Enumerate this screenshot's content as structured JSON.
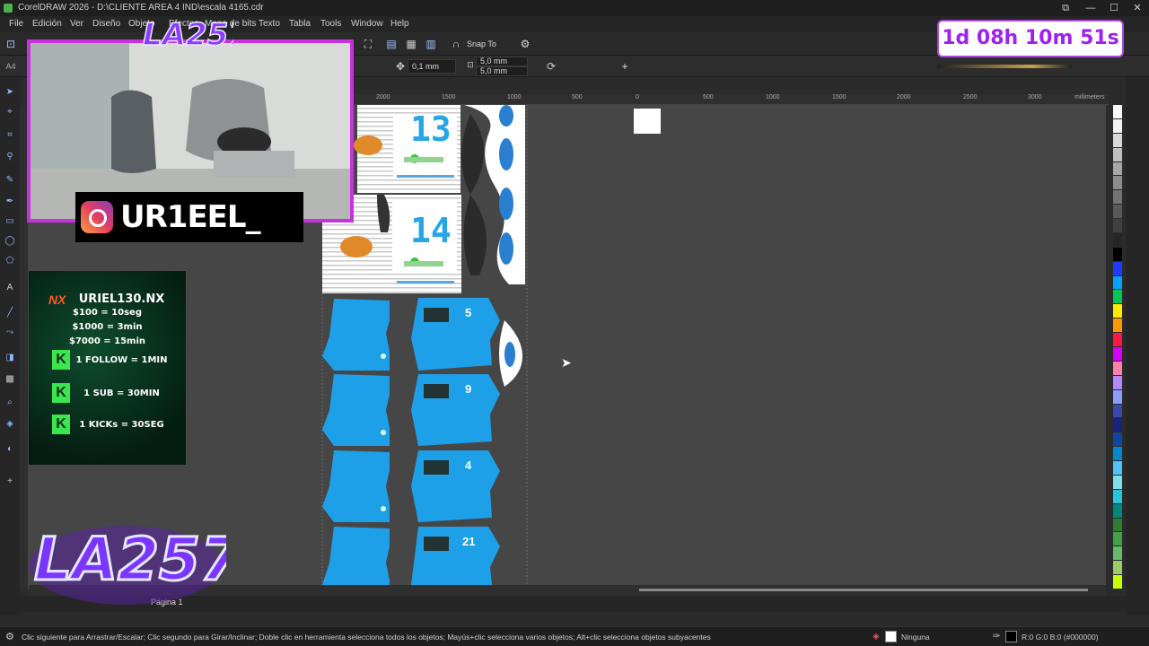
{
  "window": {
    "title": "CorelDRAW 2026 - D:\\CLIENTE AREA 4 IND\\escala 4165.cdr",
    "controls": [
      "⧉",
      "—",
      "☐",
      "✕"
    ]
  },
  "menu": [
    "File",
    "Edición",
    "Ver",
    "Diseño",
    "Objeto",
    "Efectos",
    "Mapa de bits",
    "Texto",
    "Tabla",
    "Tools",
    "Window",
    "Help"
  ],
  "toolbar": {
    "snap_label": "Snap To",
    "outline_width": "0,1 mm",
    "nudge_x": "5,0 mm",
    "nudge_y": "5,0 mm"
  },
  "ruler": {
    "labels": [
      "2000",
      "1500",
      "1000",
      "500",
      "0",
      "500",
      "1000",
      "1500",
      "2000",
      "2500",
      "3000"
    ],
    "unit": "millimeters"
  },
  "overlay": {
    "timer": "1d 08h 10m 51s",
    "instagram_handle": "UR1EEL_",
    "donation": {
      "brand": "NX",
      "name": "URIEL130.NX",
      "lines": [
        "$100 = 10seg",
        "$1000 = 3min",
        "$7000 = 15min"
      ],
      "kick_lines": [
        "1 FOLLOW = 1MIN",
        "1 SUB = 30MIN",
        "1 KICKs = 30SEG"
      ]
    },
    "logo_text": "LA257"
  },
  "canvas": {
    "jersey_numbers": [
      "13",
      "14"
    ],
    "sleeve_numbers": [
      "5",
      "9",
      "4",
      "21"
    ]
  },
  "page_tab": "Página 1",
  "status": {
    "message": "Clic siguiente para Arrastrar/Escalar; Clic segundo para Girar/Inclinar; Doble clic en herramienta selecciona todos los objetos; Mayús+clic selecciona varios objetos; Alt+clic selecciona objetos subyacentes",
    "fill": "Ninguna",
    "outline": "R:0 G:0 B:0 (#000000)"
  },
  "palette_colors": [
    "#ffffff",
    "#f2f2f2",
    "#d9d9d9",
    "#bfbfbf",
    "#a6a6a6",
    "#8c8c8c",
    "#737373",
    "#595959",
    "#404040",
    "#262626",
    "#000000",
    "#1e3cff",
    "#00a2ff",
    "#00c853",
    "#ffeb00",
    "#ff9800",
    "#ff1744",
    "#d500f9",
    "#ff80ab",
    "#b388ff",
    "#8c9eff",
    "#3949ab",
    "#1a237e",
    "#0d47a1",
    "#0288d1",
    "#4fc3f7",
    "#80deea",
    "#26c6da",
    "#00897b",
    "#2e7d32",
    "#43a047",
    "#66bb6a",
    "#9ccc65",
    "#c6ff00"
  ]
}
